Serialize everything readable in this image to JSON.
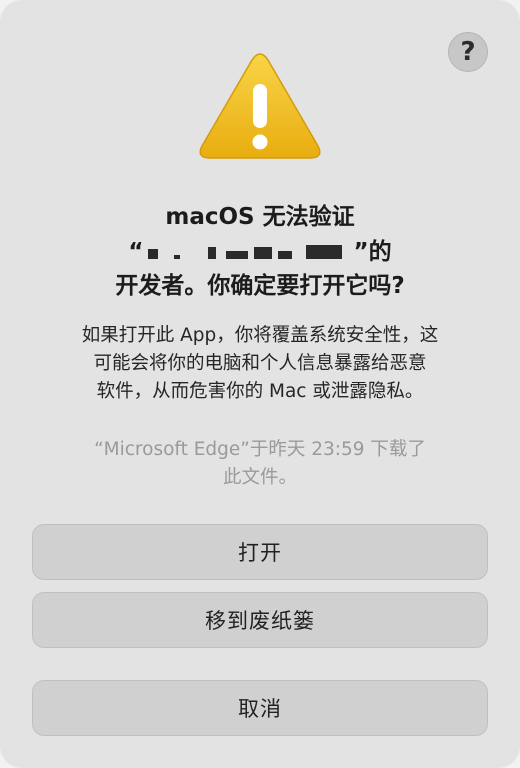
{
  "dialog": {
    "help_label": "?",
    "title_prefix": "macOS 无法验证",
    "title_quote_open": "“",
    "title_quote_close": "”的",
    "title_suffix": "开发者。你确定要打开它吗?",
    "body_lines": [
      "如果打开此 App，你将覆盖系统安全性，这",
      "可能会将你的电脑和个人信息暴露给恶意",
      "软件，从而危害你的 Mac 或泄露隐私。"
    ],
    "download_lines": [
      "“Microsoft Edge”于昨天 23:59 下载了",
      "此文件。"
    ]
  },
  "buttons": {
    "open": "打开",
    "move_to_trash": "移到废纸篓",
    "cancel": "取消"
  },
  "colors": {
    "warning_fill": "#f2c01e",
    "warning_mark": "#ffffff",
    "background": "#e3e3e3",
    "button": "#d0d0d0"
  },
  "icons": {
    "warning": "warning-triangle-icon",
    "help": "question-mark-icon"
  }
}
